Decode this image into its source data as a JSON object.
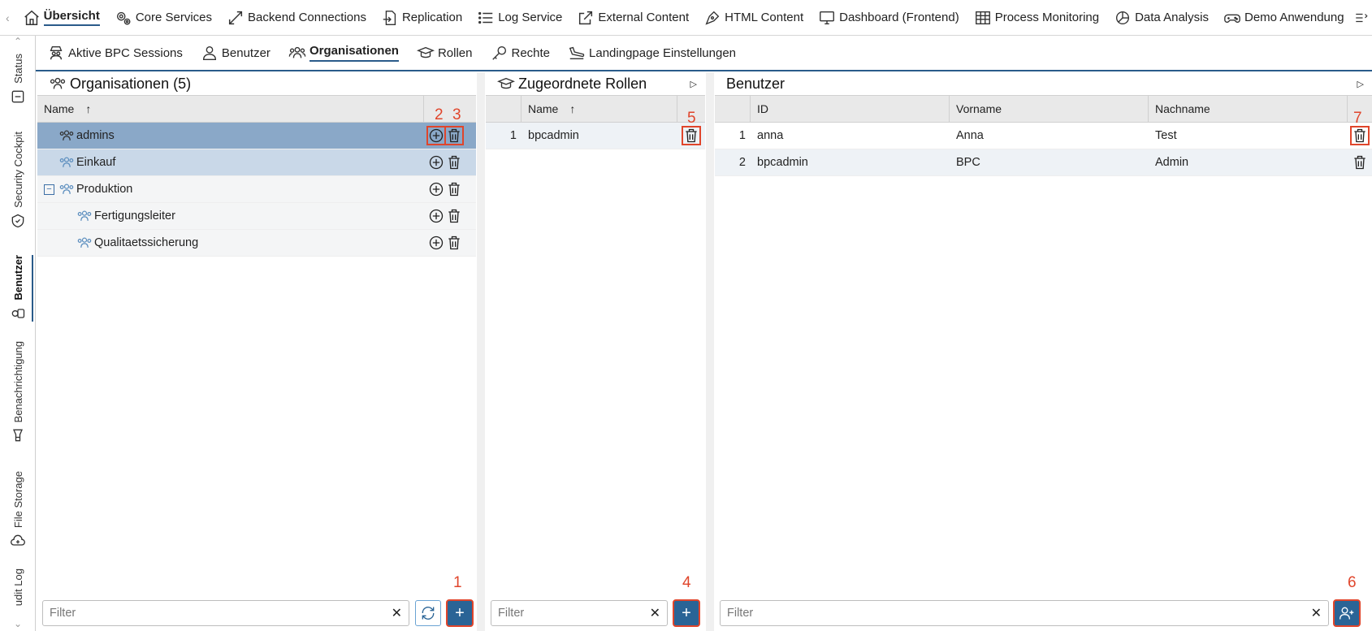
{
  "topnav": {
    "tabs": [
      {
        "label": "Übersicht",
        "icon": "home-icon",
        "active": true
      },
      {
        "label": "Core Services",
        "icon": "gears-icon"
      },
      {
        "label": "Backend Connections",
        "icon": "expand-arrows-icon"
      },
      {
        "label": "Replication",
        "icon": "file-import-icon"
      },
      {
        "label": "Log Service",
        "icon": "list-icon"
      },
      {
        "label": "External Content",
        "icon": "external-link-icon"
      },
      {
        "label": "HTML Content",
        "icon": "pen-nib-icon"
      },
      {
        "label": "Dashboard (Frontend)",
        "icon": "monitor-icon"
      },
      {
        "label": "Process Monitoring",
        "icon": "table-icon"
      },
      {
        "label": "Data Analysis",
        "icon": "pie-chart-icon"
      },
      {
        "label": "Demo Anwendung",
        "icon": "gamepad-icon"
      }
    ]
  },
  "sidebar": {
    "items": [
      {
        "label": "Status",
        "icon": "status-icon"
      },
      {
        "label": "Security Cockpit",
        "icon": "shield-icon"
      },
      {
        "label": "Benutzer",
        "icon": "user-toggle-icon",
        "active": true
      },
      {
        "label": "Benachrichtigung",
        "icon": "notification-icon"
      },
      {
        "label": "File Storage",
        "icon": "file-storage-icon"
      },
      {
        "label": "udit Log",
        "icon": "audit-icon"
      }
    ]
  },
  "subnav": {
    "tabs": [
      {
        "label": "Aktive BPC Sessions",
        "icon": "spy-icon"
      },
      {
        "label": "Benutzer",
        "icon": "user-icon"
      },
      {
        "label": "Organisationen",
        "icon": "users-icon",
        "active": true
      },
      {
        "label": "Rollen",
        "icon": "graduation-cap-icon"
      },
      {
        "label": "Rechte",
        "icon": "key-icon"
      },
      {
        "label": "Landingpage Einstellungen",
        "icon": "plane-landing-icon"
      }
    ]
  },
  "organisations": {
    "title": "Organisationen (5)",
    "col_name": "Name",
    "sort_arrow": "↑",
    "rows": [
      {
        "name": "admins",
        "level": 0,
        "selected": true
      },
      {
        "name": "Einkauf",
        "level": 0,
        "selected2": true
      },
      {
        "name": "Produktion",
        "level": 0,
        "expanded": true
      },
      {
        "name": "Fertigungsleiter",
        "level": 1
      },
      {
        "name": "Qualitaetssicherung",
        "level": 1
      }
    ],
    "filter_placeholder": "Filter",
    "clear": "✕",
    "add": "+"
  },
  "roles": {
    "title": "Zugeordnete Rollen",
    "col_name": "Name",
    "sort_arrow": "↑",
    "rows": [
      {
        "idx": "1",
        "name": "bpcadmin"
      }
    ],
    "filter_placeholder": "Filter",
    "clear": "✕",
    "add": "+"
  },
  "users": {
    "title": "Benutzer",
    "col_id": "ID",
    "col_vorname": "Vorname",
    "col_nachname": "Nachname",
    "rows": [
      {
        "idx": "1",
        "id": "anna",
        "vorname": "Anna",
        "nachname": "Test"
      },
      {
        "idx": "2",
        "id": "bpcadmin",
        "vorname": "BPC",
        "nachname": "Admin"
      }
    ],
    "filter_placeholder": "Filter",
    "clear": "✕"
  },
  "badges": {
    "b1": "1",
    "b2": "2",
    "b3": "3",
    "b4": "4",
    "b5": "5",
    "b6": "6",
    "b7": "7"
  },
  "colors": {
    "accent": "#2a6496",
    "highlight": "#e0452b",
    "selected_row": "#8aa8c8",
    "selected_row2": "#c9d8e8"
  }
}
